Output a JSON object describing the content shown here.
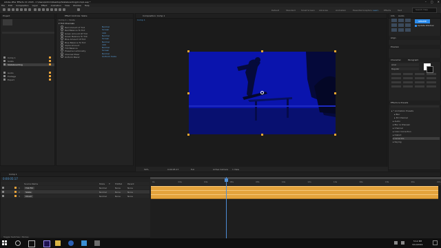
{
  "window": {
    "title": "Adobe After Effects CC 2018 - C:\\Users\\Admin\\Desktop\\Skateboarding\\Comp1.aep *"
  },
  "menu": [
    "File",
    "Edit",
    "Composition",
    "Layer",
    "Effect",
    "Animation",
    "View",
    "Window",
    "Help"
  ],
  "workspaces": [
    {
      "label": "Default",
      "active": false
    },
    {
      "label": "Standard",
      "active": false
    },
    {
      "label": "Small Screen",
      "active": false
    },
    {
      "label": "Libraries",
      "active": false
    },
    {
      "label": "Animation",
      "active": false
    },
    {
      "label": "Essential Graphics",
      "active": false
    },
    {
      "label": "Learn",
      "active": true
    },
    {
      "label": "Effects",
      "active": false
    },
    {
      "label": "Text",
      "active": false
    }
  ],
  "search_help": {
    "placeholder": "Search Help"
  },
  "project_panel": {
    "tab": "Project",
    "items": [
      "Comp 1",
      "Solids",
      "Skateboarding",
      "Audio",
      "Footage",
      "Export"
    ]
  },
  "effects_controls": {
    "tab": "Effect Controls: Skate",
    "layer": "Comp 1 • Skate",
    "header": "Tint Channels",
    "rows": [
      {
        "label": "Red Amount of Tint",
        "value": "Normal"
      },
      {
        "label": "Red Balance To Tint",
        "value": "Screen"
      },
      {
        "label": "Green Amount Of Tint",
        "value": "100"
      },
      {
        "label": "Green Balance To Tint",
        "value": "Normal"
      },
      {
        "label": "Blue Amount Of Tint",
        "value": "Screen"
      },
      {
        "label": "Blue Balance To Tint",
        "value": "Normal"
      },
      {
        "label": "Alpha Amount",
        "value": "100"
      },
      {
        "label": "Tint Balance",
        "value": "Normal"
      },
      {
        "label": "Preserve Luminosity",
        "value": "Screen"
      },
      {
        "label": "Channel Mixer",
        "value": "Normal"
      },
      {
        "label": "Uniform Blend",
        "value": "Uniform Scale"
      }
    ]
  },
  "composition_panel": {
    "tab": "Composition: Comp 1",
    "subtab": "Comp 1",
    "zoom": "50%",
    "timecode": "0:00:05:17",
    "resolution": "Full",
    "camera": "Active Camera",
    "views": "1 View"
  },
  "right_panels": {
    "info_tab": "Info",
    "audio_tab": "Audio",
    "align_tab": "Align",
    "preview_tab": "Preview",
    "character_tab": "Character",
    "paragraph_tab": "Paragraph",
    "font_name": "Arial",
    "font_style": "Regular",
    "effects_tab": "Effects & Presets",
    "effects_items": [
      "* Animation Presets",
      "Blur",
      "3D Channel",
      "Audio",
      "Blur & Sharpen",
      "Channel",
      "Color Correction",
      "Distort",
      "Generate",
      "Keying"
    ],
    "update_button": "UPDATE",
    "update_label": "Update Window"
  },
  "timeline": {
    "tab": "Comp 1",
    "timecode": "0:00:05:17",
    "columns": [
      "Source Name",
      "Mode",
      "T",
      "TrkMat",
      "Parent"
    ],
    "layers": [
      {
        "num": "1",
        "name": "Tint Fill",
        "mode": "Normal",
        "trkmat": "None",
        "parent": "None"
      },
      {
        "num": "2",
        "name": "Skate",
        "mode": "Normal",
        "trkmat": "None",
        "parent": "None"
      },
      {
        "num": "3",
        "name": "Cloud",
        "mode": "Normal",
        "trkmat": "None",
        "parent": "None"
      }
    ],
    "ruler": [
      "0s",
      "02s",
      "04s",
      "06s",
      "08s",
      "10s",
      "12s",
      "14s",
      "16s",
      "18s",
      "20s",
      "22s"
    ],
    "footer": "Toggle Switches / Modes",
    "playhead_pos_s": 5.7
  },
  "taskbar": {
    "time": "5:12 PM",
    "date": "3/12/2019"
  },
  "colors": {
    "accent": "#2d8ceb",
    "layer_bar": "#e4a33c",
    "comp_tint": "#0913a8",
    "playhead": "#4e8ed6"
  }
}
